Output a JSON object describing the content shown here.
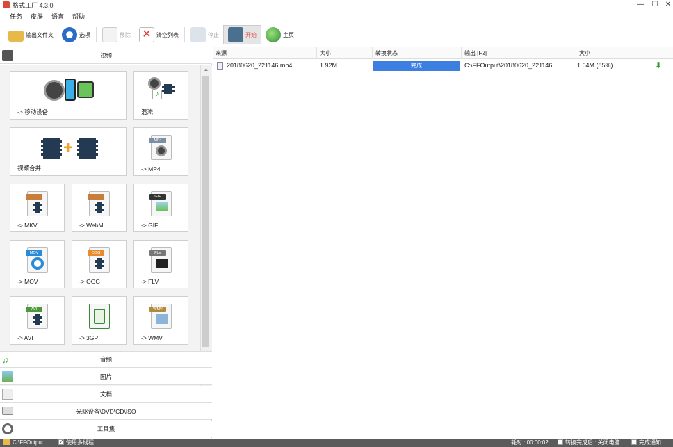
{
  "window": {
    "title": "格式工厂 4.3.0",
    "minimize": "—",
    "maximize": "☐",
    "close": "✕"
  },
  "menu": [
    "任务",
    "皮肤",
    "语言",
    "帮助"
  ],
  "toolbar": {
    "output_folder": "输出文件夹",
    "options": "选项",
    "remove": "移除",
    "clear_list": "清空列表",
    "stop": "停止",
    "start": "开始",
    "home": "主页"
  },
  "left_panel": {
    "video_header": "视频",
    "tiles": [
      {
        "label": "-> 移动设备",
        "icon": "mobile-device-icon"
      },
      {
        "label": "混流",
        "icon": "mux-icon"
      },
      {
        "label": "视频合并",
        "icon": "video-join-icon"
      },
      {
        "label": "-> MP4",
        "icon": "mp4-file-icon",
        "tag": "MP4"
      },
      {
        "label": "-> MKV",
        "icon": "mkv-file-icon",
        "tag": ""
      },
      {
        "label": "-> WebM",
        "icon": "webm-file-icon",
        "tag": ""
      },
      {
        "label": "-> GIF",
        "icon": "gif-file-icon",
        "tag": "GIF"
      },
      {
        "label": "-> MOV",
        "icon": "mov-file-icon",
        "tag": "MOV"
      },
      {
        "label": "-> OGG",
        "icon": "ogg-file-icon",
        "tag": "OGG"
      },
      {
        "label": "-> FLV",
        "icon": "flv-file-icon",
        "tag": "FLV"
      },
      {
        "label": "-> AVI",
        "icon": "avi-file-icon",
        "tag": "AVI"
      },
      {
        "label": "-> 3GP",
        "icon": "3gp-file-icon",
        "tag": ""
      },
      {
        "label": "-> WMV",
        "icon": "wmv-file-icon",
        "tag": "WMV"
      }
    ],
    "categories": [
      "音频",
      "图片",
      "文档",
      "光驱设备\\DVD\\CD\\ISO",
      "工具集"
    ]
  },
  "task_list": {
    "columns": [
      "来源",
      "大小",
      "转换状态",
      "输出 [F2]",
      "大小"
    ],
    "rows": [
      {
        "source": "20180620_221146.mp4",
        "size": "1.92M",
        "status": "完成",
        "output": "C:\\FFOutput\\20180620_221146....",
        "out_size": "1.64M  (85%)"
      }
    ]
  },
  "statusbar": {
    "path": "C:\\FFOutput",
    "multithread": "使用多线程",
    "elapsed": "耗时 : 00:00:02",
    "after_convert": "转换完成后 : 关闭电脑",
    "notify": "完成通知"
  },
  "colors": {
    "status_done": "#3d7fe0",
    "statusbar_bg": "#5b5b5b"
  }
}
